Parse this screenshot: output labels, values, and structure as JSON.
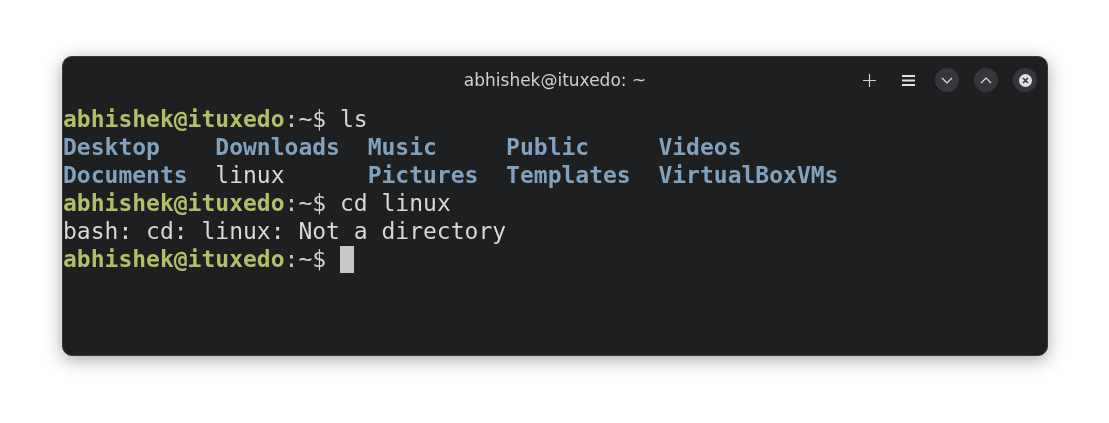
{
  "window": {
    "title": "abhishek@ituxedo: ~"
  },
  "toolbar": [
    {
      "kind": "plus"
    },
    {
      "kind": "menu"
    },
    {
      "kind": "minimize"
    },
    {
      "kind": "maximize"
    },
    {
      "kind": "close"
    }
  ],
  "lines": [
    {
      "kind": "prompt",
      "user": "abhishek@ituxedo",
      "colon": ":",
      "path": "~$",
      "command": "ls",
      "cursor": false
    },
    {
      "kind": "listing",
      "entries": [
        {
          "name": "Desktop",
          "kind": "dir"
        },
        {
          "name": "Downloads",
          "kind": "dir"
        },
        {
          "name": "Music",
          "kind": "dir"
        },
        {
          "name": "Public",
          "kind": "dir"
        },
        {
          "name": "Videos",
          "kind": "dir"
        }
      ]
    },
    {
      "kind": "listing",
      "entries": [
        {
          "name": "Documents",
          "kind": "dir"
        },
        {
          "name": "linux",
          "kind": "file"
        },
        {
          "name": "Pictures",
          "kind": "dir"
        },
        {
          "name": "Templates",
          "kind": "dir"
        },
        {
          "name": "VirtualBoxVMs",
          "kind": "dir"
        }
      ]
    },
    {
      "kind": "prompt",
      "user": "abhishek@ituxedo",
      "colon": ":",
      "path": "~$",
      "command": "cd linux",
      "cursor": false
    },
    {
      "kind": "output",
      "text": "bash: cd: linux: Not a directory"
    },
    {
      "kind": "prompt",
      "user": "abhishek@ituxedo",
      "colon": ":",
      "path": "~$",
      "cursor": true
    }
  ]
}
